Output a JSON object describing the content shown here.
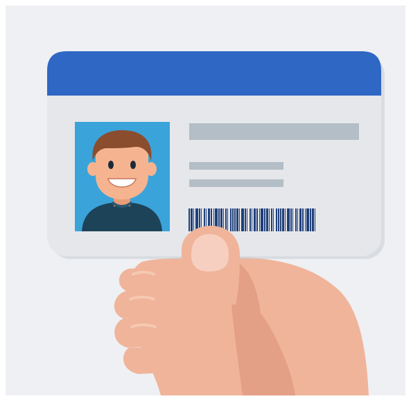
{
  "illustration": {
    "subject": "id-card-in-hand",
    "icons": [
      "id-card-icon",
      "hand-icon",
      "person-avatar-icon",
      "barcode-icon"
    ],
    "colors": {
      "background": "#eef0f4",
      "card_body": "#e6e7ea",
      "card_header": "#2f67c4",
      "photo_bg": "#3aa3da",
      "hair": "#8a4d2e",
      "skin": "#f5b48f",
      "shirt": "#1c4358",
      "placeholder_lines": "#b3bec6",
      "barcode": "#1f3f7a",
      "hand": "#f0b49a",
      "hand_shadow": "#d88f78",
      "thumb_nail": "#f7cfc0"
    }
  }
}
